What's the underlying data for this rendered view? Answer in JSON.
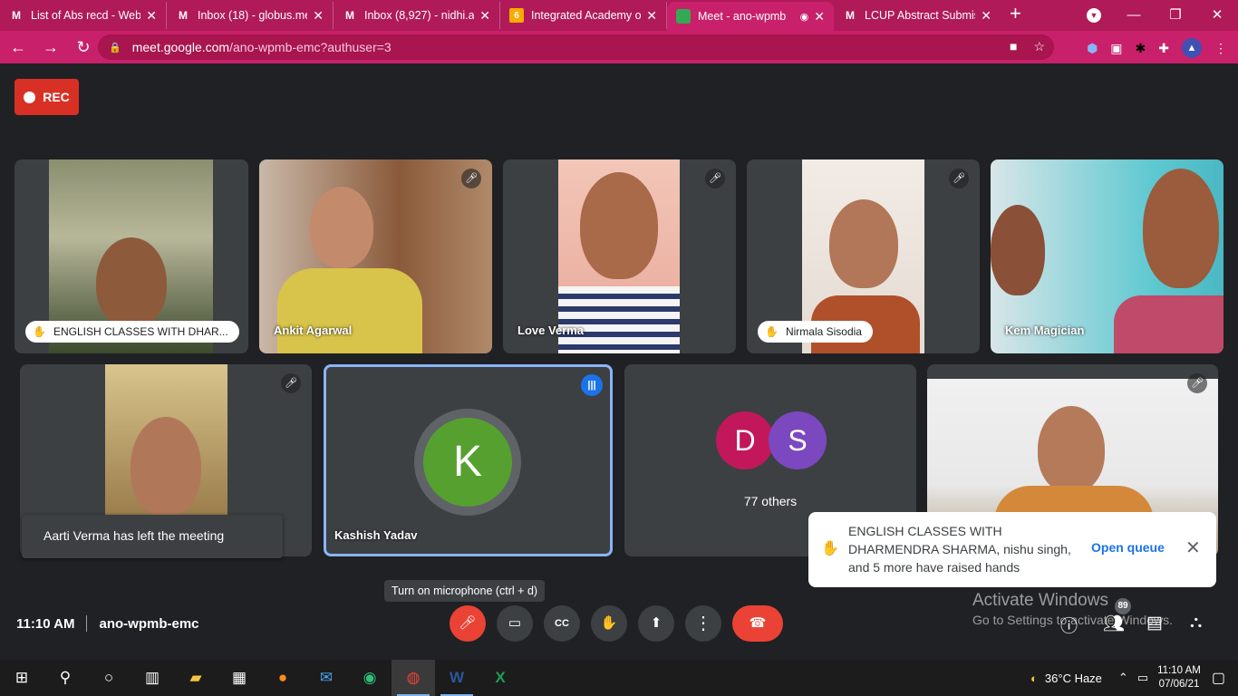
{
  "browser": {
    "tabs": [
      {
        "title": "List of Abs recd - Web",
        "icon": "gmail-icon"
      },
      {
        "title": "Inbox (18) - globus.me",
        "icon": "gmail-icon"
      },
      {
        "title": "Inbox (8,927) - nidhi.ac",
        "icon": "gmail-icon"
      },
      {
        "title": "Integrated Academy o",
        "icon": "classroom-icon"
      },
      {
        "title": "Meet - ano-wpmb",
        "icon": "meet-icon",
        "active": true
      },
      {
        "title": "LCUP Abstract Submis",
        "icon": "gmail-icon"
      }
    ],
    "url_host": "meet.google.com",
    "url_path": "/ano-wpmb-emc?authuser=3",
    "theme_color": "#b01a59"
  },
  "meet": {
    "rec_label": "REC",
    "participants_top": [
      {
        "name": "ENGLISH CLASSES WITH DHAR...",
        "hand_raised": true,
        "muted": false
      },
      {
        "name": "Ankit Agarwal",
        "hand_raised": false,
        "muted": true
      },
      {
        "name": "Love Verma",
        "hand_raised": false,
        "muted": true
      },
      {
        "name": "Nirmala Sisodia",
        "hand_raised": true,
        "muted": true
      },
      {
        "name": "Kem Magician",
        "hand_raised": false,
        "muted": false
      }
    ],
    "participants_bottom": [
      {
        "name": "",
        "muted": true
      },
      {
        "name": "Kashish Yadav",
        "initial": "K",
        "avatar_color": "#56a030",
        "speaking": true
      },
      {
        "others_label": "77 others",
        "initials": [
          "D",
          "S"
        ],
        "colors": [
          "#c2185b",
          "#7b48c0"
        ]
      },
      {
        "name": "",
        "muted": true
      }
    ],
    "toast": "Aarti Verma has left the meeting",
    "hand_queue": {
      "message": "ENGLISH CLASSES WITH DHARMENDRA SHARMA, nishu singh, and 5 more have raised hands",
      "open_label": "Open queue"
    },
    "tooltip": "Turn on microphone (ctrl + d)",
    "time": "11:10 AM",
    "meeting_code": "ano-wpmb-emc",
    "people_count": "89"
  },
  "activate_windows": {
    "line1": "Activate Windows",
    "line2": "Go to Settings to activate Windows."
  },
  "taskbar": {
    "weather": "36°C  Haze",
    "clock_time": "11:10 AM",
    "clock_date": "07/06/21"
  }
}
